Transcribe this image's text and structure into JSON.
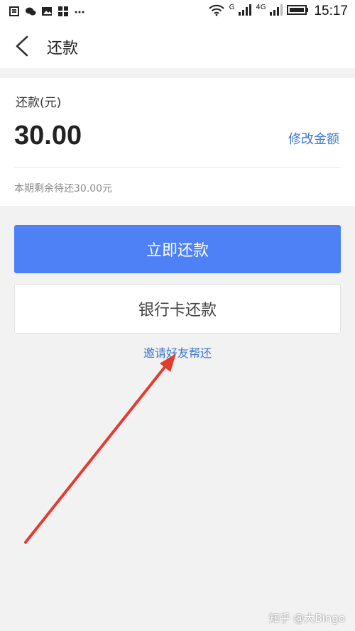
{
  "status_bar": {
    "time": "15:17",
    "network_1": "G",
    "network_2": "4G",
    "icons": [
      "sim-icon",
      "wechat-icon",
      "image-icon",
      "app-icon",
      "more-dots-icon",
      "wifi-icon",
      "signal-icon",
      "signal-icon",
      "battery-icon"
    ]
  },
  "nav": {
    "title": "还款"
  },
  "amount": {
    "label": "还款(元)",
    "value": "30.00",
    "modify_label": "修改金额",
    "remaining": "本期剩余待还30.00元"
  },
  "actions": {
    "primary_label": "立即还款",
    "secondary_label": "银行卡还款",
    "invite_label": "邀请好友帮还"
  },
  "watermark": "知乎 @大Bingo",
  "colors": {
    "primary": "#4e80f6",
    "link": "#3d78cf",
    "arrow": "#e53a2f"
  }
}
